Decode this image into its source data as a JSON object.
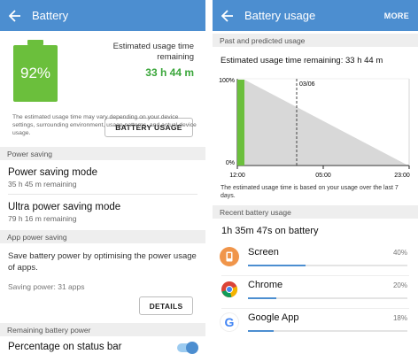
{
  "left": {
    "appbar": {
      "title": "Battery"
    },
    "battery": {
      "percent_text": "92%",
      "level": 0.92
    },
    "estimate": {
      "label": "Estimated usage time remaining",
      "value": "33 h 44 m"
    },
    "usage_button": "BATTERY USAGE",
    "note": "The estimated usage time may vary depending on your device settings, surrounding environment, usage patterns, and actual device usage.",
    "sections": {
      "power_saving": "Power saving",
      "app_power_saving": "App power saving",
      "remaining": "Remaining battery power"
    },
    "power_saving_mode": {
      "title": "Power saving mode",
      "subtitle": "35 h 45 m remaining"
    },
    "ultra_power_saving_mode": {
      "title": "Ultra power saving mode",
      "subtitle": "79 h 16 m remaining"
    },
    "app_saving": {
      "text": "Save battery power by optimising the power usage of apps.",
      "saving": "Saving power: 31 apps",
      "details_button": "DETAILS"
    },
    "percentage_status_bar": {
      "label": "Percentage on status bar",
      "enabled": true
    }
  },
  "right": {
    "appbar": {
      "title": "Battery usage",
      "more": "MORE"
    },
    "past_header": "Past and predicted usage",
    "estimate_text": "Estimated usage time remaining: 33 h 44 m",
    "graph": {
      "y_top": "100%",
      "y_bottom": "0%",
      "marker_label": "03/06",
      "x_labels": [
        "12:00",
        "05:00",
        "23:00"
      ]
    },
    "graph_note": "The estimated usage time is based on your usage over the last 7 days.",
    "recent_header": "Recent battery usage",
    "on_battery": "1h 35m 47s on battery",
    "apps": [
      {
        "name": "Screen",
        "percent_text": "40%",
        "fraction": 0.4,
        "icon": "screen-icon",
        "color": "#f0954a"
      },
      {
        "name": "Chrome",
        "percent_text": "20%",
        "fraction": 0.2,
        "icon": "chrome-icon",
        "color": "#ffffff"
      },
      {
        "name": "Google App",
        "percent_text": "18%",
        "fraction": 0.18,
        "icon": "google-g-icon",
        "color": "#ffffff"
      }
    ]
  },
  "colors": {
    "appbar": "#4c8ed0",
    "battery_green": "#6bbf3c",
    "value_green": "#3aa63a",
    "accent_blue": "#4c8ed0"
  }
}
